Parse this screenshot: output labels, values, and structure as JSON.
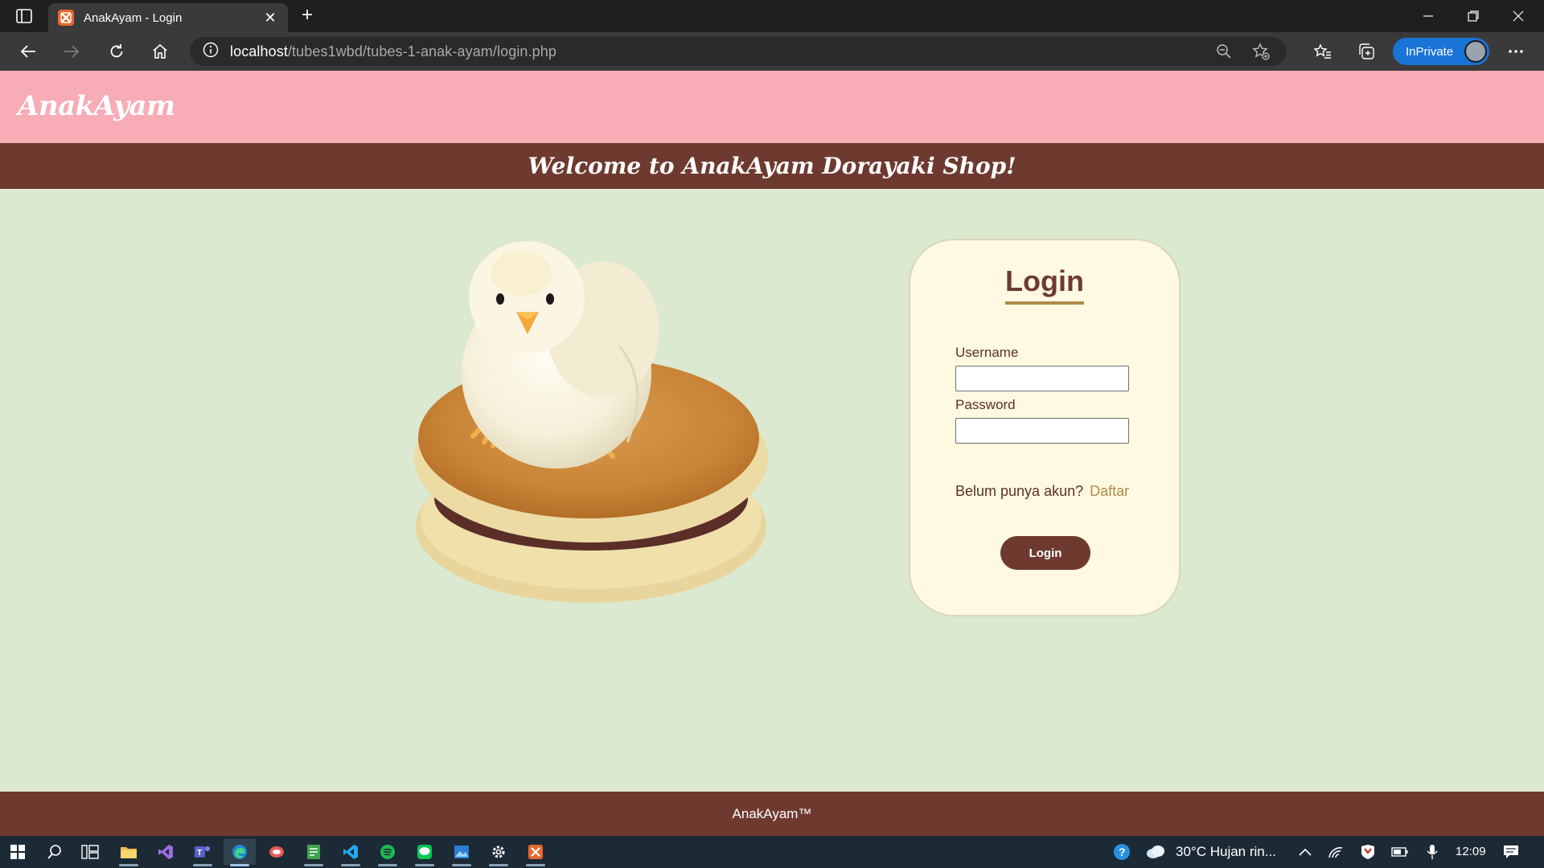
{
  "browser": {
    "tab_title": "AnakAyam - Login",
    "tab_close": "✕",
    "new_tab": "+",
    "url_host": "localhost",
    "url_path": "/tubes1wbd/tubes-1-anak-ayam/login.php",
    "inprivate_label": "InPrivate"
  },
  "header": {
    "logo": "AnakAyam",
    "welcome": "Welcome to AnakAyam Dorayaki Shop!"
  },
  "hero": {
    "image": "chick-on-dorayaki"
  },
  "login": {
    "title": "Login",
    "username_label": "Username",
    "username_value": "",
    "password_label": "Password",
    "password_value": "",
    "register_prompt": "Belum punya akun?",
    "register_link": "Daftar",
    "submit_label": "Login"
  },
  "footer": {
    "text": "AnakAyam™"
  },
  "taskbar": {
    "weather": "30°C  Hujan rin...",
    "time": "12:09"
  },
  "colors": {
    "header_pink": "#f7acb6",
    "brown": "#6e3a30",
    "background_green": "#dae9cf",
    "card_cream": "#fef9e0",
    "accent_gold": "#b08a4c"
  }
}
